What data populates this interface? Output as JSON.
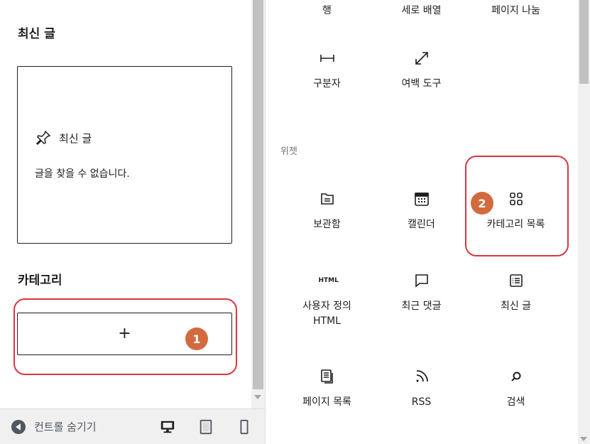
{
  "left": {
    "recent_posts_title": "최신 글",
    "recent_box": {
      "header": "최신 글",
      "empty_message": "글을 찾을 수 없습니다."
    },
    "categories_title": "카테고리",
    "add_button": "+"
  },
  "bottom_bar": {
    "collapse_label": "컨트롤 숨기기",
    "devices": [
      "desktop-icon",
      "tablet-icon",
      "mobile-icon"
    ]
  },
  "badges": {
    "one": "1",
    "two": "2"
  },
  "inserter": {
    "top_row": [
      "행",
      "세로 배열",
      "페이지 나눔"
    ],
    "layout_row": [
      {
        "icon": "separator-icon",
        "label": "구분자"
      },
      {
        "icon": "spacer-icon",
        "label": "여백 도구"
      }
    ],
    "widgets_category": "위젯",
    "widgets": [
      {
        "icon": "archive-icon",
        "label": "보관함"
      },
      {
        "icon": "calendar-icon",
        "label": "캘린더"
      },
      {
        "icon": "categories-icon",
        "label": "카테고리 목록"
      },
      {
        "icon": "html-icon",
        "icon_text": "HTML",
        "label": "사용자 정의 HTML"
      },
      {
        "icon": "comments-icon",
        "label": "최근 댓글"
      },
      {
        "icon": "latest-posts-icon",
        "label": "최신 글"
      },
      {
        "icon": "page-list-icon",
        "label": "페이지 목록"
      },
      {
        "icon": "rss-icon",
        "label": "RSS"
      },
      {
        "icon": "search-icon",
        "label": "검색"
      }
    ]
  },
  "colors": {
    "callout": "#d9363e",
    "badge": "#d36a3f"
  }
}
